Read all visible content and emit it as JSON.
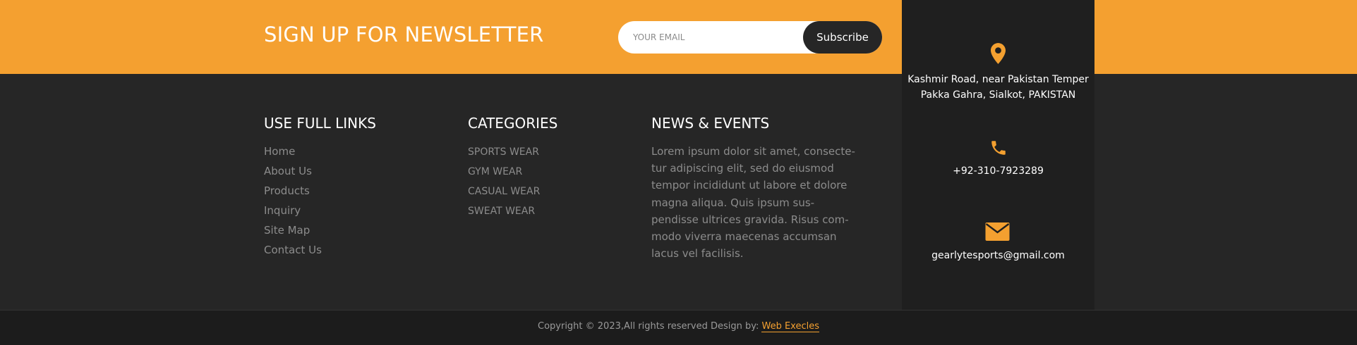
{
  "newsletter": {
    "title": "SIGN UP FOR NEWSLETTER",
    "email_placeholder": "YOUR EMAIL",
    "subscribe_label": "Subscribe"
  },
  "useful_links": {
    "title": "USE FULL LINKS",
    "items": [
      "Home",
      "About Us",
      "Products",
      "Inquiry",
      "Site Map",
      "Contact Us"
    ]
  },
  "categories": {
    "title": "CATEGORIES",
    "items": [
      "SPORTS WEAR",
      "GYM WEAR",
      "CASUAL WEAR",
      "SWEAT WEAR"
    ]
  },
  "news": {
    "title": "NEWS & EVENTS",
    "text": "Lorem ipsum dolor sit amet, consecte-tur adipiscing elit, sed do eiusmod tempor incididunt ut labore et dolore magna aliqua. Quis ipsum sus-pendisse ultrices gravida. Risus com-modo viverra maecenas accumsan lacus vel facilisis."
  },
  "contact": {
    "address_line1": "Kashmir Road, near Pakistan Temper",
    "address_line2": "Pakka Gahra, Sialkot, PAKISTAN",
    "phone": "+92-310-7923289",
    "email": "gearlytesports@gmail.com",
    "icons": [
      "map-pin-icon",
      "phone-icon",
      "envelope-icon"
    ]
  },
  "footer": {
    "copyright": "Copyright © 2023,All rights reserved Design by: ",
    "designer": "Web Execles"
  },
  "colors": {
    "accent": "#f4a030",
    "background": "#262626",
    "contact_panel": "#1f1f1f",
    "bottom_bar": "#1c1c1c"
  }
}
